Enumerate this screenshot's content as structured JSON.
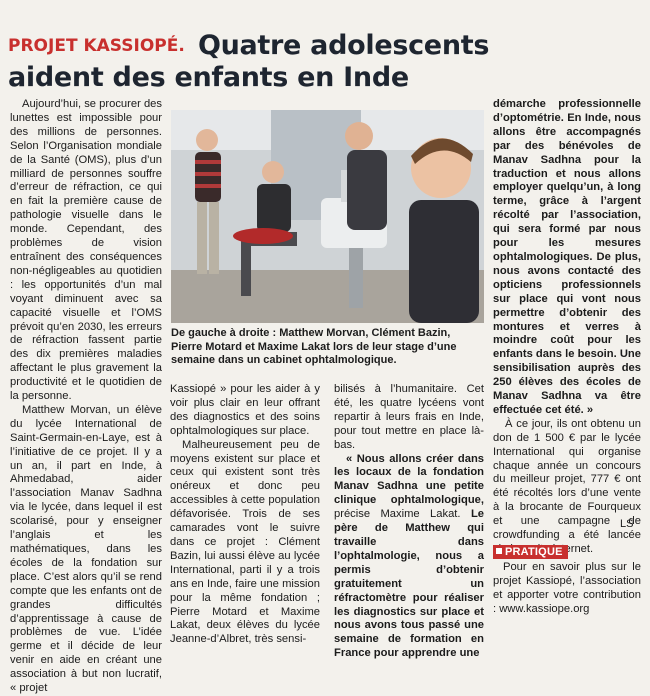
{
  "headline": {
    "rubric": "PROJET KASSIOPÉ.",
    "title_line1": "Quatre adolescents",
    "title_line2": "aident des enfants en Inde"
  },
  "photo": {
    "caption": "De gauche à droite : Matthew Morvan, Clément Bazin, Pierre Motard et Maxime Lakat lors de leur stage d’une semaine dans un cabinet ophtalmologique."
  },
  "column1": {
    "p1": "Aujourd’hui, se procurer des lunettes est impossible pour des millions de personnes. Selon l’Organisation mondiale de la Santé (OMS), plus d’un milliard de personnes souffre d’erreur de réfraction, ce qui en fait la première cause de pathologie visuelle dans le monde. Cependant, des problèmes de vision entraînent des conséquences non-négligeables au quotidien : les opportunités d’un mal voyant diminuent avec sa capacité visuelle et l’OMS prévoit qu’en 2030, les erreurs de réfraction fassent partie des dix premières maladies affectant le plus gravement la productivité et le quotidien de la personne.",
    "p2": "Matthew Morvan, un élève du lycée International de Saint-Germain-en-Laye, est à l’initiative de ce projet. Il y a un an, il part en Inde, à Ahmedabad, aider l’association Manav Sadhna via le lycée, dans lequel il est scolarisé, pour y enseigner l’anglais et les mathématiques, dans les écoles de la fondation sur place. C’est alors qu’il se rend compte que les enfants ont de grandes difficultés d’apprentissage à cause de problèmes de vue. L’idée germe et il décide de leur venir en aide en créant une association à but non lucratif, « projet"
  },
  "column2": {
    "p1": "Kassiopé » pour les aider à y voir plus clair en leur offrant des diagnostics et des soins ophtalmologiques sur place.",
    "p2": "Malheureusement peu de moyens existent sur place et ceux qui existent sont très onéreux et donc peu accessibles à cette population défavorisée. Trois de ses camarades vont le suivre dans ce projet : Clément Bazin, lui aussi élève au lycée International, parti il y a trois ans en Inde, faire une mission pour la même fondation ; Pierre Motard et Maxime Lakat, deux élèves du lycée Jeanne-d’Albret, très sensi-"
  },
  "column3": {
    "p1": "bilisés à l’humanitaire. Cet été, les quatre lycéens vont repartir à leurs frais en Inde, pour tout mettre en place là-bas.",
    "p2_bold": "« Nous allons créer dans les locaux de la fondation Manav Sadhna une petite clinique ophtalmologique,",
    "p2_rest": " précise Maxime Lakat.",
    "p2_bold2": " Le père de Matthew qui travaille dans l’ophtalmologie, nous a permis d’obtenir gratuitement un réfractomètre pour réaliser les diagnostics sur place et nous avons tous passé une semaine de formation en France pour apprendre une"
  },
  "column4": {
    "p1_bold": "démarche professionnelle d’optométrie. En Inde, nous allons être accompagnés par des bénévoles de Manav Sadhna pour la traduction et nous allons employer quelqu’un, à long terme, grâce à l’argent récolté par l’association, qui sera formé par nous pour les mesures ophtalmologiques. De plus, nous avons contacté des opticiens professionnels sur place qui vont nous permettre d’obtenir des montures et verres à moindre coût pour les enfants dans le besoin. Une sensibilisation auprès des 250 élèves des écoles de Manav Sadhna va être effectuée cet été. »",
    "p2": "À ce jour, ils ont obtenu un don de 1 500 € par le lycée International qui organise chaque année un concours du meilleur projet, 777 € ont été récoltés lors d’une vente à la brocante de Fourqueux et une campagne de crowdfunding a été lancée via leur site internet."
  },
  "signature": "LS",
  "pratique": {
    "label": "PRATIQUE",
    "text": "Pour en savoir plus sur le projet Kassiopé, l’association et apporter votre contribution : www.kassiope.org"
  }
}
